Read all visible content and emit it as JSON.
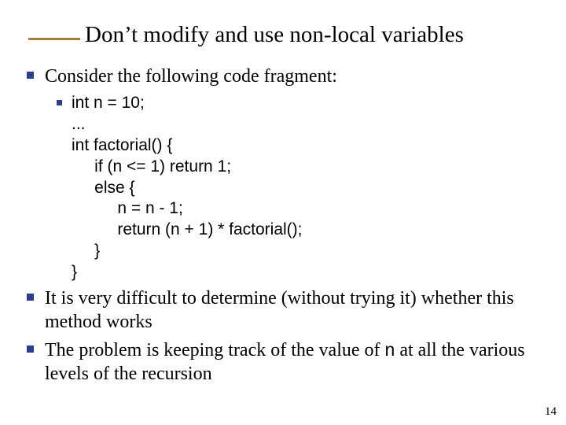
{
  "title": "Don’t modify and use non-local variables",
  "bullets": {
    "b1": "Consider the following code fragment:",
    "code": "int n = 10;\n...\nint factorial() {\n     if (n <= 1) return 1;\n     else {\n          n = n - 1;\n          return (n + 1) * factorial();\n     }\n}",
    "b2_pre": "It is very difficult to determine (without trying it) whether this method works",
    "b3_pre": "The problem is keeping track of the value of ",
    "b3_code": "n",
    "b3_post": " at all the various levels of the recursion"
  },
  "page_number": "14"
}
